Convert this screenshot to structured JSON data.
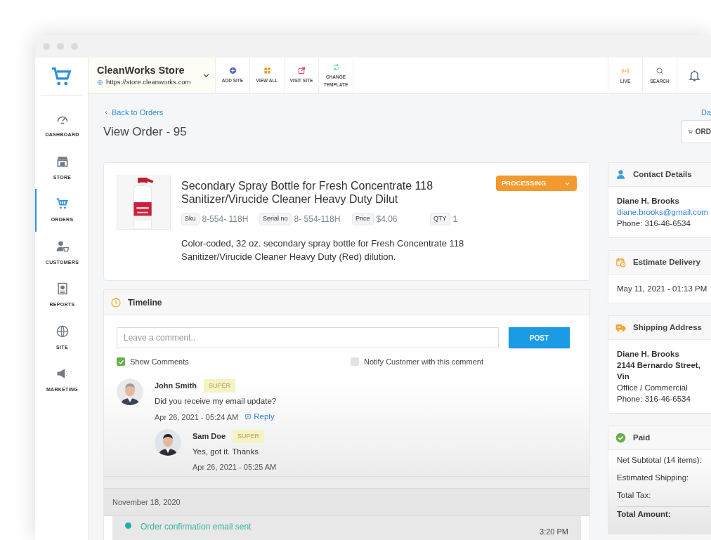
{
  "store": {
    "name": "CleanWorks Store",
    "url": "https://store.cleanworks.com"
  },
  "toolbar": [
    {
      "label": "ADD SITE",
      "kind": "add"
    },
    {
      "label": "VIEW ALL",
      "kind": "grid"
    },
    {
      "label": "VISIT SITE",
      "kind": "visit"
    },
    {
      "label": "CHANGE TEMPLATE",
      "kind": "template"
    }
  ],
  "top_actions": [
    {
      "label": "LIVE",
      "kind": "live"
    },
    {
      "label": "SEARCH",
      "kind": "search"
    },
    {
      "kind": "bell"
    }
  ],
  "sidebar": {
    "items": [
      {
        "label": "DASHBOARD",
        "kind": "dashboard",
        "selected": false
      },
      {
        "label": "STORE",
        "kind": "store",
        "selected": false
      },
      {
        "label": "ORDERS",
        "kind": "orders",
        "selected": true
      },
      {
        "label": "CUSTOMERS",
        "kind": "customers",
        "selected": false
      },
      {
        "label": "REPORTS",
        "kind": "reports",
        "selected": false
      },
      {
        "label": "SITE",
        "kind": "site",
        "selected": false
      },
      {
        "label": "MARKETING",
        "kind": "marketing",
        "selected": false
      }
    ]
  },
  "page": {
    "back_link": "Back to Orders",
    "title": "View Order - 95",
    "right_link": "Da",
    "right_button": "ORD"
  },
  "product": {
    "title": "Secondary Spray Bottle for Fresh Concentrate 118 Sanitizer/Virucide Cleaner Heavy Duty Dilut",
    "status": "PROCESSING",
    "meta": [
      {
        "label": "Sku",
        "value": "8-554- 118H"
      },
      {
        "label": "Serial no",
        "value": "8- 554-118H"
      },
      {
        "label": "Price",
        "value": "$4.06"
      },
      {
        "label": "QTY",
        "value": "1"
      }
    ],
    "description": "Color-coded, 32 oz. secondary spray bottle for Fresh Concentrate 118 Sanitizer/Virucide Cleaner Heavy Duty (Red) dilution."
  },
  "timeline": {
    "title": "Timeline",
    "comment": {
      "placeholder": "Leave a comment.."
    },
    "post": "POST",
    "options": [
      {
        "label": "Show Comments",
        "checked": true
      },
      {
        "label": "Notify Customer with this comment",
        "checked": false
      }
    ],
    "comments": [
      {
        "author": "John Smith",
        "badge": "SUPER",
        "text": "Did you receive my email update?",
        "time": "Apr 26, 2021 - 05:24 AM",
        "reply": "Reply",
        "children": [
          {
            "author": "Sam Doe",
            "badge": "SUPER",
            "text": "Yes, got it. Thanks",
            "time": "Apr 26, 2021 - 05:25 AM"
          }
        ]
      }
    ],
    "date_group": "November 18, 2020",
    "events": [
      {
        "text": "Order confirmation email sent",
        "time": "3:20 PM"
      }
    ]
  },
  "side_cards": [
    {
      "kind": "contact",
      "title": "Contact Details",
      "lines": [
        {
          "kind": "strong",
          "text": "Diane H. Brooks"
        },
        {
          "kind": "link",
          "text": "diane.brooks@gmail.com"
        },
        {
          "kind": "plain",
          "text": "Phone:  316-46-6534"
        }
      ]
    },
    {
      "kind": "delivery",
      "title": "Estimate Delivery",
      "lines": [
        {
          "kind": "plain",
          "text": "May 11, 2021 - 01:13 PM"
        }
      ]
    },
    {
      "kind": "shipping",
      "title": "Shipping Address",
      "lines": [
        {
          "kind": "strong",
          "text": "Diane H. Brooks"
        },
        {
          "kind": "strong",
          "text": "2144 Bernardo Street, Vin"
        },
        {
          "kind": "plain",
          "text": "Office / Commercial"
        },
        {
          "kind": "plain",
          "text": "Phone: 316-46-6534"
        }
      ]
    },
    {
      "kind": "paid",
      "title": "Paid",
      "lines": [
        {
          "kind": "row",
          "text": "Net Subtotal (14 items):"
        },
        {
          "kind": "row",
          "text": "Estimated Shipping:"
        },
        {
          "kind": "row",
          "text": "Total Tax:"
        },
        {
          "kind": "total",
          "text": "Total Amount:"
        }
      ]
    }
  ]
}
